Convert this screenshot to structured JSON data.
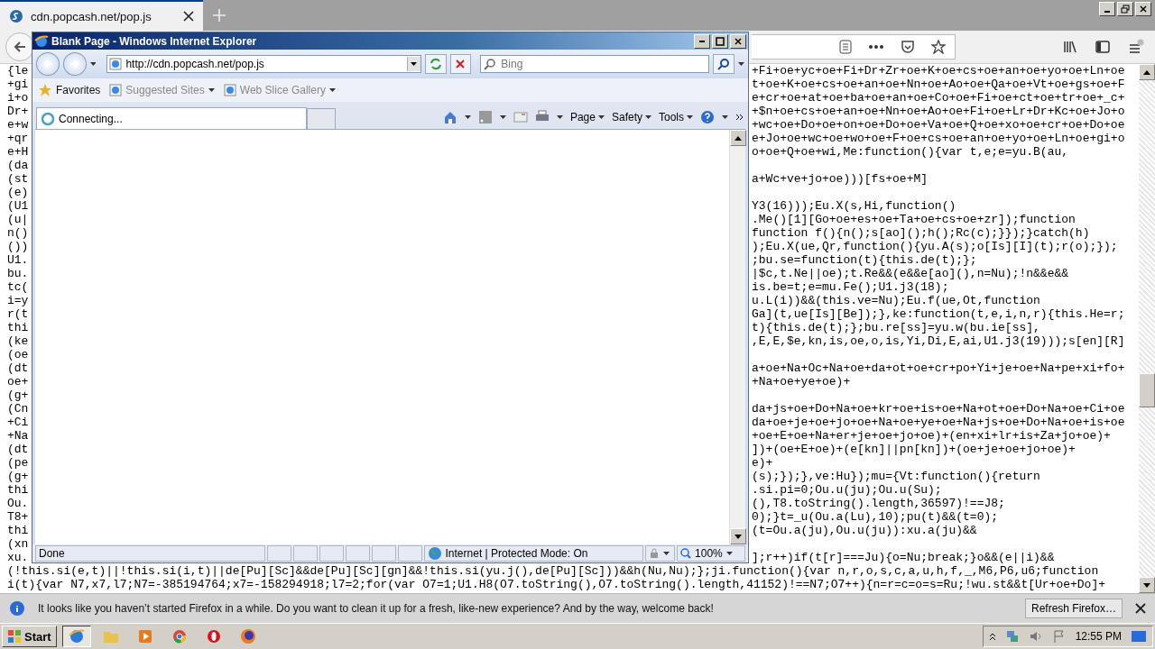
{
  "firefox": {
    "tabs": [
      {
        "title": "cdn.popcash.net/pop.js",
        "selected": true
      }
    ],
    "code_rows": [
      {
        "kind": "split",
        "left": "{le",
        "right": "+Fi+oe+yc+oe+Fi+Dr+Zr+oe+K+oe+cs+oe+an+oe+yo+oe+Ln+oe"
      },
      {
        "kind": "split",
        "left": "+gi",
        "right": "t+oe+K+oe+cs+oe+an+oe+Nn+oe+Ao+oe+Qa+oe+Vt+oe+gs+oe+F"
      },
      {
        "kind": "split",
        "left": "i+o",
        "right": "e+cr+oe+at+oe+ba+oe+an+oe+Co+oe+Fi+oe+ct+oe+tr+oe+_c+"
      },
      {
        "kind": "split",
        "left": "Dr+",
        "right": "+$n+oe+cs+oe+an+oe+Nn+oe+Ao+oe+Fi+oe+Lr+Dr+Kc+oe+Jo+o"
      },
      {
        "kind": "split",
        "left": "e+w",
        "right": "+wc+oe+Do+oe+on+oe+Do+oe+Va+oe+Q+oe+xo+oe+cr+oe+Do+oe"
      },
      {
        "kind": "split",
        "left": "+qr",
        "right": "e+Jo+oe+wc+oe+wo+oe+F+oe+cs+oe+an+oe+yo+oe+Ln+oe+gi+o"
      },
      {
        "kind": "split",
        "left": "e+H",
        "right": "o+oe+Q+oe+wi,Me:function(){var t,e;e=yu.B(au,"
      },
      {
        "kind": "split",
        "left": "(da"
      },
      {
        "kind": "split",
        "left": "(st",
        "right": "a+Wc+ve+jo+oe)))[fs+oe+M]"
      },
      {
        "kind": "split",
        "left": "(e)"
      },
      {
        "kind": "split",
        "left": "(U1",
        "right": "Y3(16)));Eu.X(s,Hi,function()"
      },
      {
        "kind": "split",
        "left": "(u|",
        "right": ".Me()[1][Go+oe+es+oe+Ta+oe+cs+oe+zr]);function"
      },
      {
        "kind": "split",
        "left": "n()",
        "right": "function f(){n();s[ao]();h();Rc(c);}});}catch(h)"
      },
      {
        "kind": "split",
        "left": "())",
        "right": ");Eu.X(ue,Qr,function(){yu.A(s);o[Is][I](t);r(o);});"
      },
      {
        "kind": "split",
        "left": "U1.",
        "right": ";bu.se=function(t){this.de(t);};"
      },
      {
        "kind": "split",
        "left": "bu.",
        "right": "|$c,t.Ne||oe);t.Re&&(e&&e[ao](),n=Nu);!n&&e&&"
      },
      {
        "kind": "split",
        "left": "tc(",
        "right": "is.be=t;e=mu.Fe();U1.j3(18);"
      },
      {
        "kind": "split",
        "left": "i=y",
        "right": "u.L(i))&&(this.ve=Nu);Eu.f(ue,Ot,function"
      },
      {
        "kind": "split",
        "left": "r(t",
        "right": "Ga](t,ue[Is][Be]);},ke:function(t,e,i,n,r){this.He=r;"
      },
      {
        "kind": "split",
        "left": "thi",
        "right": "t){this.de(t);};bu.re[ss]=yu.w(bu.ie[ss],"
      },
      {
        "kind": "split",
        "left": "(ke",
        "right": ",E,E,$e,kn,is,oe,o,is,Yi,Di,E,ai,U1.j3(19)));s[en][R]"
      },
      {
        "kind": "split",
        "left": "(oe"
      },
      {
        "kind": "split",
        "left": "(dt",
        "right": "a+oe+Na+Oc+Na+oe+da+ot+oe+cr+po+Yi+je+oe+Na+pe+xi+fo+"
      },
      {
        "kind": "split",
        "left": "oe+",
        "right": "+Na+oe+ye+oe)+"
      },
      {
        "kind": "split",
        "left": "(g+"
      },
      {
        "kind": "split",
        "left": "(Cn",
        "right": "da+js+oe+Do+Na+oe+kr+oe+is+oe+Na+ot+oe+Do+Na+oe+Ci+oe"
      },
      {
        "kind": "split",
        "left": "+Ci",
        "right": "da+oe+je+oe+jo+oe+Na+oe+ye+oe+Na+js+oe+Do+Na+oe+is+oe"
      },
      {
        "kind": "split",
        "left": "+Na",
        "right": "+oe+E+oe+Na+er+je+oe+jo+oe)+(en+xi+lr+is+Za+jo+oe)+"
      },
      {
        "kind": "split",
        "left": "(dt",
        "right": "])+(oe+E+oe)+(e[kn]||pn[kn])+(oe+je+oe+jo+oe)+"
      },
      {
        "kind": "split",
        "left": "(pe",
        "right": "e)+"
      },
      {
        "kind": "split",
        "left": "(g+",
        "right": "(s);});},ve:Hu});mu={Vt:function(){return"
      },
      {
        "kind": "split",
        "left": "thi",
        "right": ".si.pi=0;Ou.u(ju);Ou.u(Su);"
      },
      {
        "kind": "split",
        "left": "Ou.",
        "right": "(),T8.toString().length,36597)!==J8;"
      },
      {
        "kind": "split",
        "left": "T8+",
        "right": "0);}t=_u(Ou.a(Lu),10);pu(t)&&(t=0);"
      },
      {
        "kind": "split",
        "left": "thi",
        "right": "(t=Ou.a(ju),Ou.u(ju)):xu.a(ju)&&"
      },
      {
        "kind": "split",
        "left": "(xn"
      },
      {
        "kind": "split",
        "left": "xu.",
        "right": "];r++)if(t[r]===Ju){o=Nu;break;}o&&(e||i)&&"
      },
      {
        "kind": "full",
        "text": "(!this.si(e,t)||!this.si(i,t)||de[Pu][Sc]&&de[Pu][Sc][gn]&&!this.si(yu.j(),de[Pu][Sc]))&&h(Nu,Nu);};ji.function(){var n,r,o,s,c,a,u,h,f,_,M6,P6,u6;function"
      },
      {
        "kind": "full",
        "text": "i(t){var N7,x7,l7;N7=-385194764;x7=-158294918;l7=2;for(var O7=1;U1.H8(O7.toString(),O7.toString().length,41152)!==N7;O7++){n=r=c=o=s=Ru;!wu.st&&t[Ur+oe+Do]+"
      }
    ],
    "notification": {
      "message": "It looks like you haven’t started Firefox in a while. Do you want to clean it up for a fresh, like-new experience? And by the way, welcome back!",
      "button": "Refresh Firefox…"
    }
  },
  "ie": {
    "title": "Blank Page - Windows Internet Explorer",
    "address": "http://cdn.popcash.net/pop.js",
    "search": {
      "placeholder": "Bing"
    },
    "favorites": [
      {
        "label": "Favorites",
        "disabled": false
      },
      {
        "label": "Suggested Sites",
        "disabled": true
      },
      {
        "label": "Web Slice Gallery",
        "disabled": true
      }
    ],
    "tab": "Connecting...",
    "menus": [
      "Page",
      "Safety",
      "Tools"
    ],
    "status": "Done",
    "zone": "Internet | Protected Mode: On",
    "zoom": "100%"
  },
  "taskbar": {
    "start": "Start",
    "apps": [
      {
        "kind": "ie",
        "selected": true
      },
      {
        "kind": "folder",
        "selected": false
      },
      {
        "kind": "media",
        "selected": false
      },
      {
        "kind": "chrome",
        "selected": false
      },
      {
        "kind": "opera",
        "selected": false
      },
      {
        "kind": "firefox",
        "selected": false
      }
    ],
    "clock": "12:55 PM"
  }
}
